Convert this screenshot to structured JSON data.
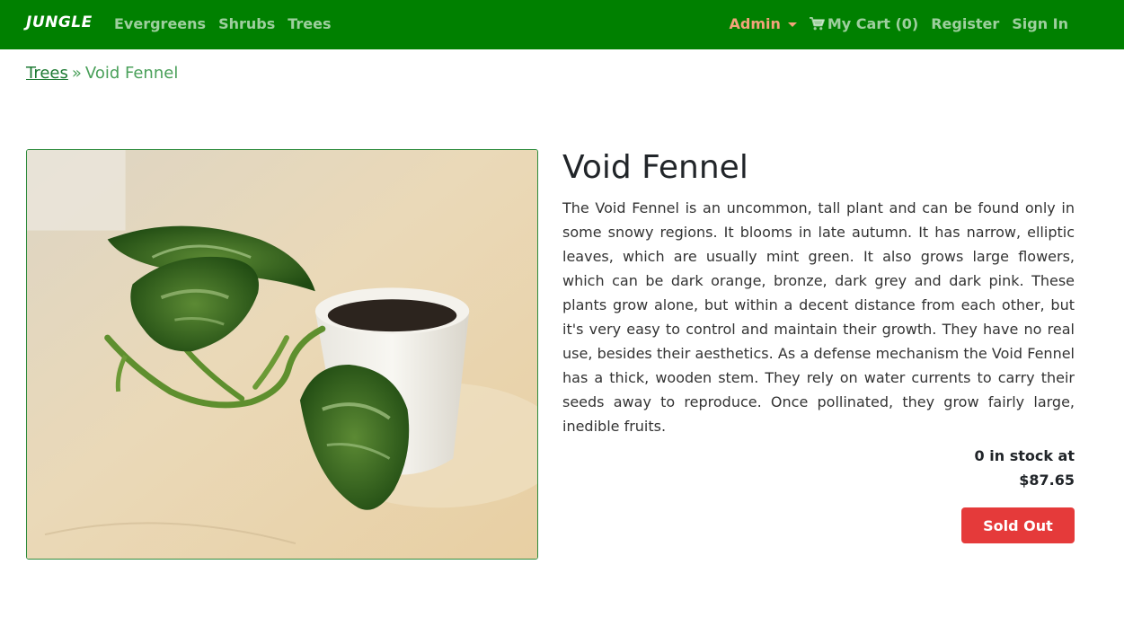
{
  "navbar": {
    "brand": "JUNGLE",
    "left_links": [
      "Evergreens",
      "Shrubs",
      "Trees"
    ],
    "admin_label": "Admin",
    "cart_label": "My Cart (0)",
    "register_label": "Register",
    "signin_label": "Sign In",
    "colors": {
      "background": "#008000",
      "admin": "#f3a37a"
    }
  },
  "breadcrumb": {
    "category": "Trees",
    "separator": "»",
    "current": "Void Fennel"
  },
  "product": {
    "name": "Void Fennel",
    "description": "The Void Fennel is an uncommon, tall plant and can be found only in some snowy regions. It blooms in late autumn. It has narrow, elliptic leaves, which are usually mint green. It also grows large flowers, which can be dark orange, bronze, dark grey and dark pink. These plants grow alone, but within a decent distance from each other, but it's very easy to control and maintain their growth. They have no real use, besides their aesthetics. As a defense mechanism the Void Fennel has a thick, wooden stem. They rely on water currents to carry their seeds away to reproduce. Once pollinated, they grow fairly large, inedible fruits.",
    "stock_text": "0 in stock at",
    "price": "$87.65",
    "sold_out_label": "Sold Out",
    "colors": {
      "sold_out": "#e53a3a"
    }
  }
}
